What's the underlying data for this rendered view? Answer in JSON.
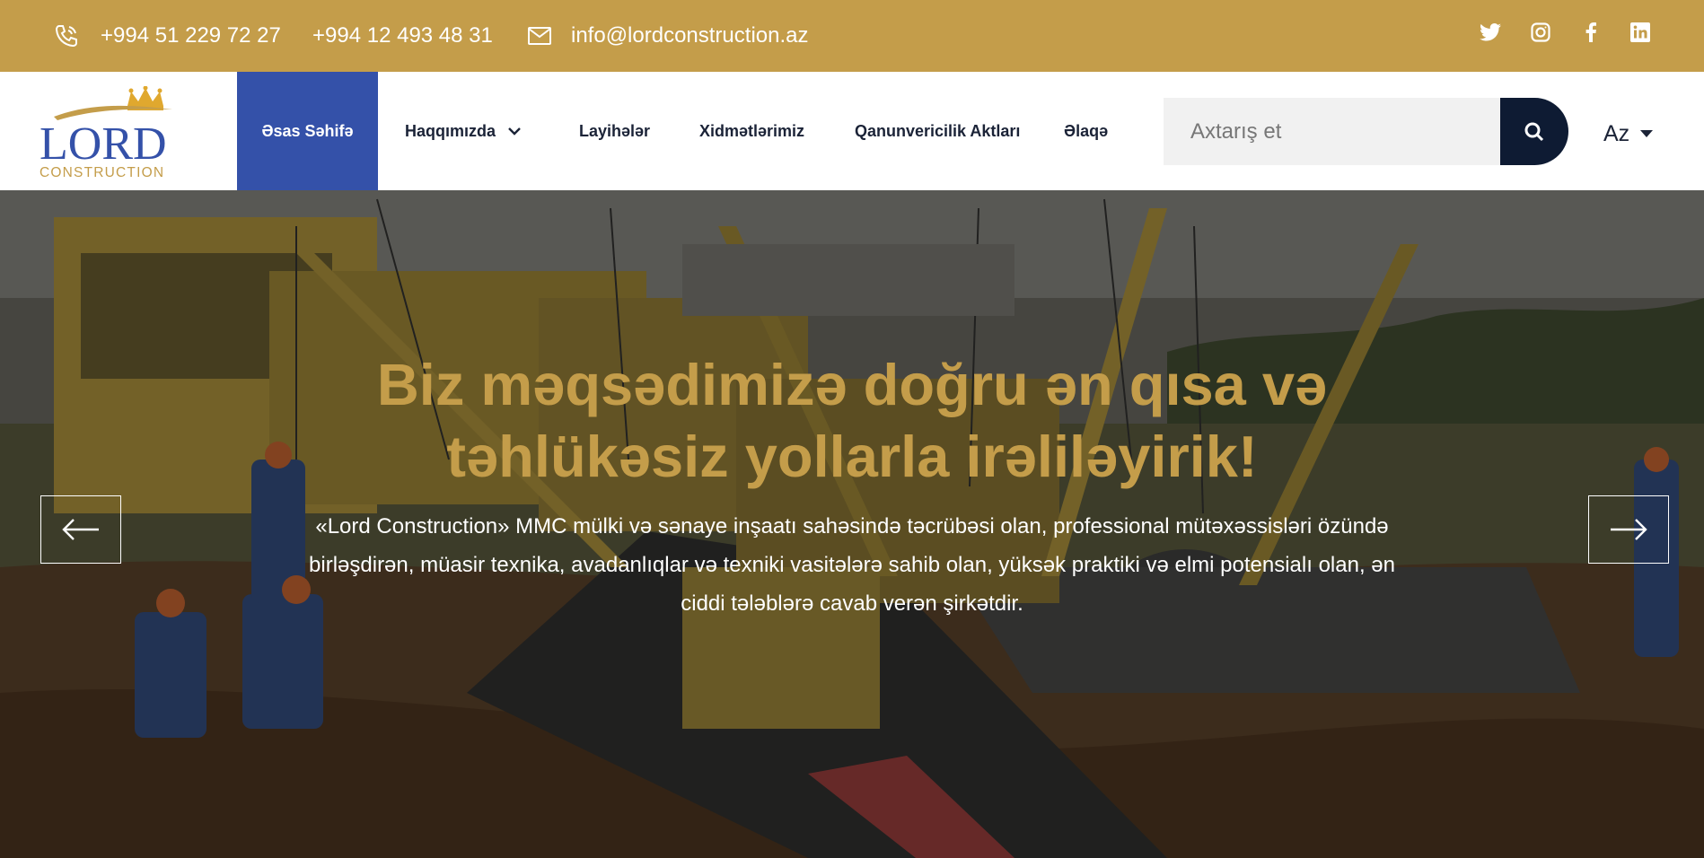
{
  "topbar": {
    "phone1": "+994 51 229 72 27",
    "phone2": "+994 12 493 48 31",
    "email": "info@lordconstruction.az",
    "bg_color": "#c49d4a",
    "social": [
      "twitter-icon",
      "instagram-icon",
      "facebook-icon",
      "linkedin-icon"
    ]
  },
  "logo": {
    "brand": "LORD",
    "sub": "CONSTRUCTION"
  },
  "nav": {
    "items": [
      {
        "label": "Əsas Səhifə",
        "active": true
      },
      {
        "label": "Haqqımızda",
        "has_dropdown": true
      },
      {
        "label": "Layihələr"
      },
      {
        "label": "Xidmətlərimiz"
      },
      {
        "label": "Qanunvericilik Aktları"
      },
      {
        "label": "Əlaqə"
      }
    ],
    "active_color": "#3451a9"
  },
  "search": {
    "placeholder": "Axtarış et"
  },
  "language": {
    "selected": "Az"
  },
  "hero": {
    "title_line1": "Biz məqsədimizə doğru ən qısa və",
    "title_line2": "təhlükəsiz yollarla irəliləyirik!",
    "text_line1": "«Lord Construction» MMC mülki və sənaye inşaatı sahəsində təcrübəsi olan, professional mütəxəssisləri özündə",
    "text_line2": "birləşdirən, müasir texnika, avadanlıqlar və texniki vasitələrə sahib olan, yüksək praktiki və elmi potensialı olan, ən",
    "text_line3": "ciddi tələblərə cavab verən şirkətdir.",
    "title_color": "#c49d4a"
  }
}
